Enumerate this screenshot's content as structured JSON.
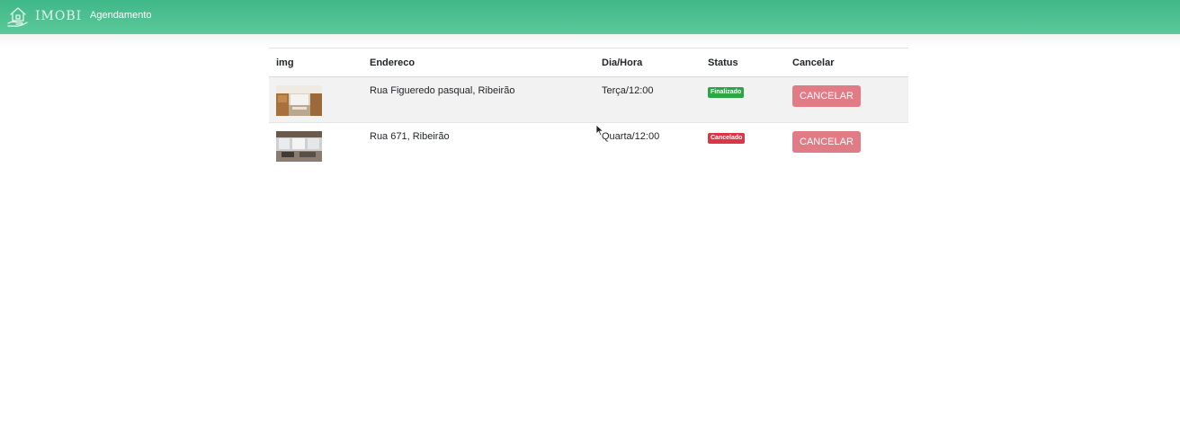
{
  "navbar": {
    "brand": "IMOBI",
    "brand_icon": "house-hand-icon",
    "links": [
      {
        "label": "Agendamento"
      }
    ],
    "colors": {
      "gradient_start": "#3fb887",
      "gradient_end": "#5cc89a"
    }
  },
  "table": {
    "headers": [
      "img",
      "Endereco",
      "Dia/Hora",
      "Status",
      "Cancelar"
    ],
    "rows": [
      {
        "image": "kitchen-photo",
        "endereco": "Rua Figueredo pasqual, Ribeirão",
        "dia_hora": "Terça/12:00",
        "status": "Finalizado",
        "status_color": "#28a745",
        "cancel_label": "CANCELAR"
      },
      {
        "image": "living-room-photo",
        "endereco": "Rua 671, Ribeirão",
        "dia_hora": "Quarta/12:00",
        "status": "Cancelado",
        "status_color": "#dc3545",
        "cancel_label": "CANCELAR"
      }
    ]
  },
  "colors": {
    "cancel_button": "#e17b86"
  }
}
